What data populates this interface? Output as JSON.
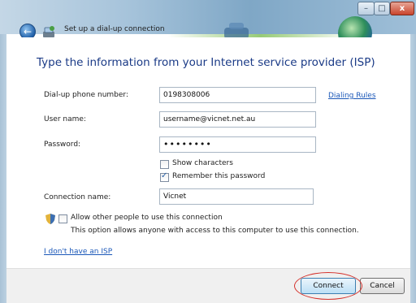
{
  "window": {
    "title": "Set up a dial-up connection",
    "controls": {
      "minimize": "–",
      "maximize": "□",
      "close": "x"
    },
    "back_glyph": "←"
  },
  "heading": "Type the information from your Internet service provider (ISP)",
  "fields": {
    "phone": {
      "label": "Dial-up phone number:",
      "value": "0198308006"
    },
    "username": {
      "label": "User name:",
      "value": "username@vicnet.net.au"
    },
    "password": {
      "label": "Password:",
      "value": "••••••••"
    },
    "connection_name": {
      "label": "Connection name:",
      "value": "Vicnet"
    }
  },
  "links": {
    "dialing_rules": "Dialing Rules",
    "no_isp": "I don't have an ISP"
  },
  "checkboxes": {
    "show_characters": {
      "label": "Show characters",
      "checked": false
    },
    "remember_password": {
      "label": "Remember this password",
      "checked": true
    },
    "allow_others": {
      "label": "Allow other people to use this connection",
      "checked": false
    }
  },
  "allow_others_note": "This option allows anyone with access to this computer to use this connection.",
  "buttons": {
    "connect": "Connect",
    "cancel": "Cancel"
  },
  "icons": {
    "back": "back-arrow-icon",
    "app": "dialup-connection-icon",
    "shield": "uac-shield-icon",
    "check": "✓"
  },
  "colors": {
    "heading": "#1a3a86",
    "link": "#1a57b8",
    "highlight_ring": "#d4302a"
  }
}
